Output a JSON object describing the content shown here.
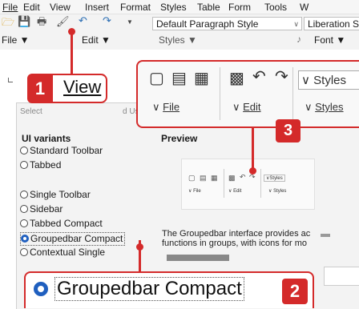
{
  "menubar": {
    "items": [
      {
        "label": "File",
        "u": "F"
      },
      {
        "label": "Edit",
        "u": "E"
      },
      {
        "label": "View",
        "u": "V"
      },
      {
        "label": "Insert",
        "u": "I"
      },
      {
        "label": "Format",
        "u": "o"
      },
      {
        "label": "Styles",
        "u": "y"
      },
      {
        "label": "Table",
        "u": "a"
      },
      {
        "label": "Form",
        "u": "r"
      },
      {
        "label": "Tools",
        "u": "T"
      },
      {
        "label": "W",
        "u": "W"
      }
    ]
  },
  "toolbar": {
    "paragraph_style": "Default Paragraph Style",
    "font_name": "Liberation S",
    "file_group": "File",
    "edit_group": "Edit",
    "styles_group": "Styles",
    "font_group": "Font"
  },
  "callout1": {
    "number": "1",
    "label": "View"
  },
  "callout2": {
    "number": "2",
    "label": "Groupedbar Compact"
  },
  "callout3": {
    "number": "3",
    "groups": [
      "File",
      "Edit",
      "Styles"
    ],
    "style_label": "Styles"
  },
  "dialog": {
    "title_fragment": "Select",
    "title_fragment2": "d Us",
    "ui_variants_heading": "UI variants",
    "preview_heading": "Preview",
    "variants": [
      {
        "label": "Standard Toolbar",
        "selected": false
      },
      {
        "label": "Tabbed",
        "selected": false
      },
      {
        "label": "Single Toolbar",
        "selected": false
      },
      {
        "label": "Sidebar",
        "selected": false
      },
      {
        "label": "Tabbed Compact",
        "selected": false
      },
      {
        "label": "Groupedbar Compact",
        "selected": true
      },
      {
        "label": "Contextual Single",
        "selected": false
      }
    ],
    "preview": {
      "file": "File",
      "edit": "Edit",
      "styles": "Styles",
      "styles2": "Styles"
    },
    "description": "The Groupedbar interface provides ac functions in groups, with icons for mo"
  },
  "colors": {
    "accent": "#d42a2a",
    "radio_selected": "#1f5fbf"
  }
}
